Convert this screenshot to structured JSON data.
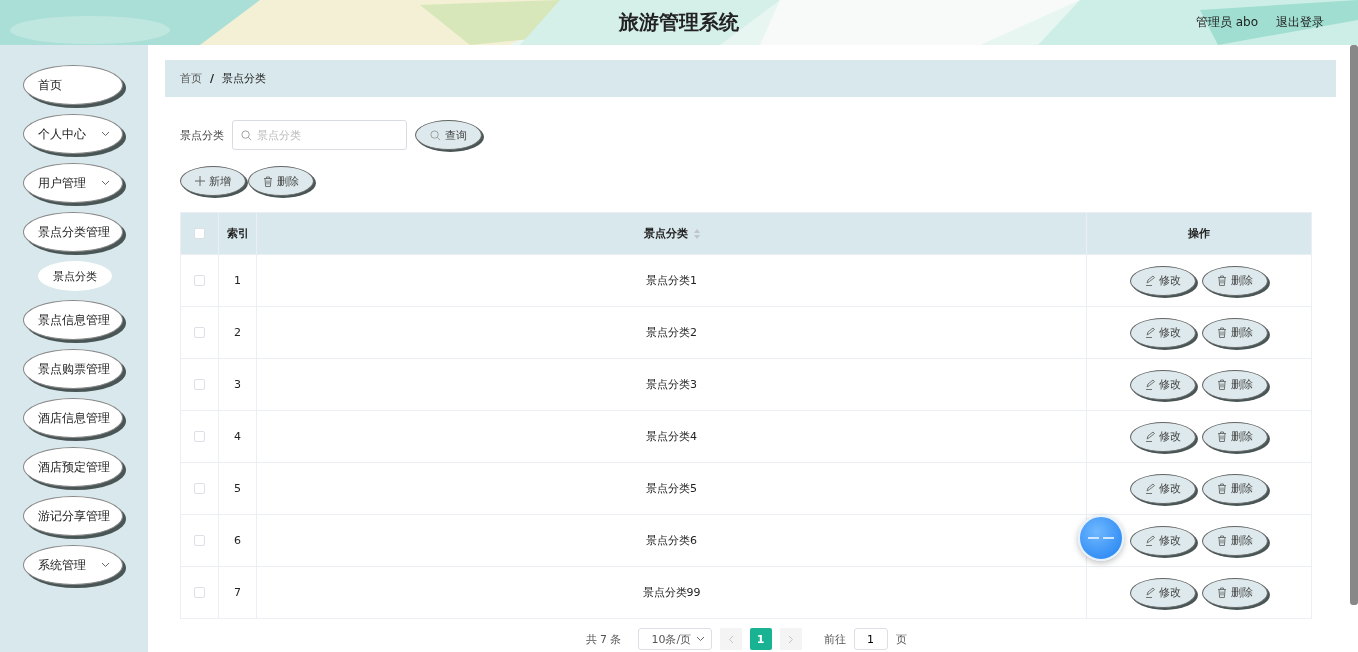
{
  "header": {
    "title": "旅游管理系统",
    "user": "管理员 abo",
    "logout": "退出登录"
  },
  "sidebar": {
    "items": [
      {
        "label": "首页",
        "kind": "link"
      },
      {
        "label": "个人中心",
        "kind": "group"
      },
      {
        "label": "用户管理",
        "kind": "group"
      },
      {
        "label": "景点分类管理",
        "kind": "link",
        "children": [
          {
            "label": "景点分类",
            "selected": true
          }
        ]
      },
      {
        "label": "景点信息管理",
        "kind": "link"
      },
      {
        "label": "景点购票管理",
        "kind": "link"
      },
      {
        "label": "酒店信息管理",
        "kind": "link"
      },
      {
        "label": "酒店预定管理",
        "kind": "link"
      },
      {
        "label": "游记分享管理",
        "kind": "link"
      },
      {
        "label": "系统管理",
        "kind": "group"
      }
    ]
  },
  "breadcrumb": [
    "首页",
    "景点分类"
  ],
  "breadcrumb_separator": "/",
  "search": {
    "label": "景点分类",
    "placeholder": "景点分类",
    "button": "查询"
  },
  "toolbar": [
    {
      "label": "新增",
      "kind": "add"
    },
    {
      "label": "删除",
      "kind": "delete"
    }
  ],
  "table": {
    "header_checked": false,
    "columns": [
      {
        "label": "索引",
        "sortable": false
      },
      {
        "label": "景点分类",
        "sortable": true
      },
      {
        "label": "操作",
        "sortable": false
      }
    ],
    "rows": [
      {
        "checked": false,
        "index": "1",
        "name": "景点分类1",
        "actions": [
          "修改",
          "删除"
        ]
      },
      {
        "checked": false,
        "index": "2",
        "name": "景点分类2",
        "actions": [
          "修改",
          "删除"
        ]
      },
      {
        "checked": false,
        "index": "3",
        "name": "景点分类3",
        "actions": [
          "修改",
          "删除"
        ]
      },
      {
        "checked": false,
        "index": "4",
        "name": "景点分类4",
        "actions": [
          "修改",
          "删除"
        ]
      },
      {
        "checked": false,
        "index": "5",
        "name": "景点分类5",
        "actions": [
          "修改",
          "删除"
        ]
      },
      {
        "checked": false,
        "index": "6",
        "name": "景点分类6",
        "actions": [
          "修改",
          "删除"
        ]
      },
      {
        "checked": false,
        "index": "7",
        "name": "景点分类99",
        "actions": [
          "修改",
          "删除"
        ]
      }
    ]
  },
  "pagination": {
    "total": "共 7 条",
    "page_size": "10条/页",
    "pages": [
      {
        "label": "1",
        "selected": true
      }
    ],
    "goto_label": "前往",
    "goto_value": "1",
    "goto_suffix": "页"
  }
}
